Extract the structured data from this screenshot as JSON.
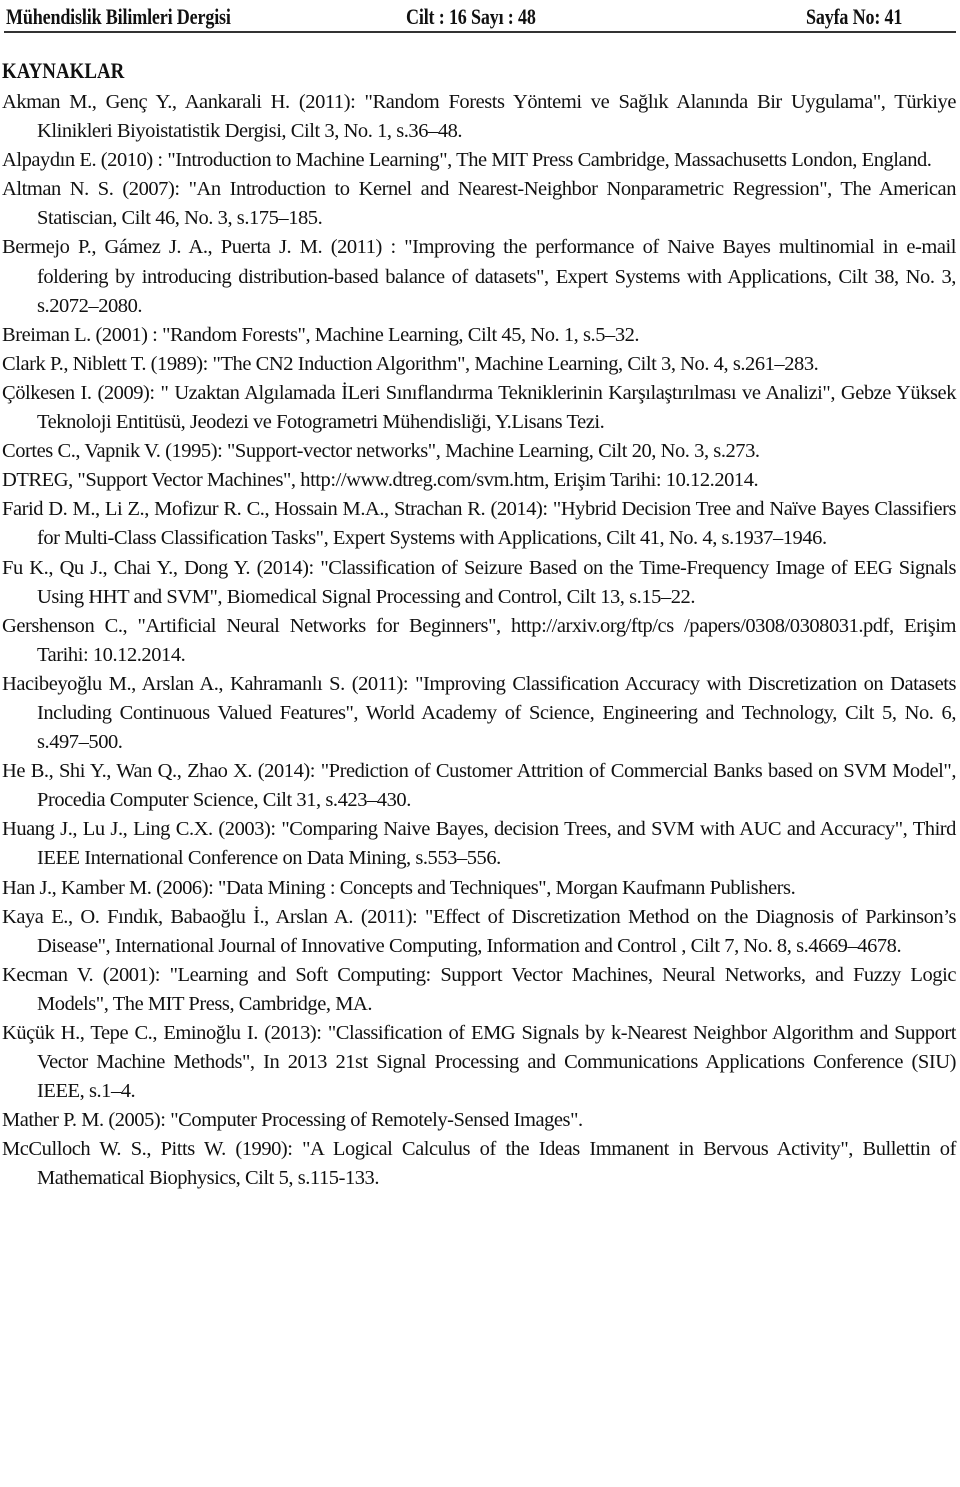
{
  "header": {
    "journal": "Mühendislik Bilimleri Dergisi",
    "issue": "Cilt : 16 Sayı : 48",
    "page": "Sayfa No: 41"
  },
  "section_title": "KAYNAKLAR",
  "references": [
    "Akman M., Genç Y., Aankarali H. (2011): \"Random Forests Yöntemi ve Sağlık Alanında Bir Uygulama\", Türkiye Klinikleri Biyoistatistik Dergisi, Cilt 3, No. 1, s.36–48.",
    "Alpaydın E. (2010) : \"Introduction to Machine Learning\", The MIT Press Cambridge, Massachusetts London, England.",
    "Altman N. S. (2007): \"An Introduction to Kernel and Nearest-Neighbor Nonparametric Regression\", The American Statiscian, Cilt 46, No. 3, s.175–185.",
    "Bermejo P., Gámez J. A., Puerta J. M. (2011) : \"Improving the performance of Naive Bayes multinomial in e-mail foldering by introducing distribution-based balance of datasets\", Expert Systems with Applications, Cilt 38, No. 3, s.2072–2080.",
    "Breiman L. (2001) : \"Random Forests\", Machine Learning, Cilt 45, No. 1, s.5–32.",
    "Clark P., Niblett T. (1989): \"The CN2 Induction Algorithm\",  Machine Learning,  Cilt 3, No. 4, s.261–283.",
    "Çölkesen I. (2009): \" Uzaktan Algılamada İLeri Sınıflandırma Tekniklerinin Karşılaştırılması ve Analizi\", Gebze Yüksek Teknoloji Entitüsü, Jeodezi ve Fotogrametri Mühendisliği, Y.Lisans Tezi.",
    "Cortes C., Vapnik V. (1995): \"Support-vector networks\", Machine Learning, Cilt 20, No. 3, s.273.",
    "DTREG, \"Support Vector Machines\", http://www.dtreg.com/svm.htm, Erişim Tarihi: 10.12.2014.",
    "Farid D. M., Li Z., Mofizur R. C., Hossain M.A., Strachan R. (2014): \"Hybrid Decision Tree and Naïve Bayes Classifiers for Multi-Class Classification Tasks\", Expert Systems with Applications, Cilt 41, No. 4, s.1937–1946.",
    "Fu K., Qu J., Chai Y., Dong Y. (2014): \"Classification of Seizure Based on the Time-Frequency Image of EEG Signals Using HHT and SVM\", Biomedical Signal Processing and Control, Cilt 13, s.15–22.",
    "Gershenson C., \"Artificial Neural Networks for Beginners\", http://arxiv.org/ftp/cs /papers/0308/0308031.pdf, Erişim Tarihi: 10.12.2014.",
    "Hacibeyoğlu M., Arslan A., Kahramanlı S. (2011): \"Improving Classification Accuracy with Discretization on Datasets Including Continuous Valued Features\", World Academy of Science, Engineering and Technology, Cilt 5, No. 6, s.497–500.",
    "He B., Shi Y., Wan Q., Zhao X. (2014): \"Prediction of Customer Attrition of Commercial Banks based on SVM Model\", Procedia Computer Science, Cilt 31, s.423–430.",
    "Huang J., Lu J., Ling C.X. (2003): \"Comparing Naive Bayes, decision Trees, and SVM with AUC and Accuracy\", Third IEEE International Conference on Data Mining, s.553–556.",
    "Han J., Kamber M. (2006):  \"Data Mining : Concepts and Techniques\", Morgan Kaufmann Publishers.",
    "Kaya E., O. Fındık, Babaoğlu İ., Arslan A. (2011): \"Effect of Discretization Method on the Diagnosis of Parkinson’s Disease\", International Journal of Innovative Computing, Information and Control , Cilt 7, No. 8, s.4669–4678.",
    "Kecman V. (2001): \"Learning and Soft Computing: Support Vector Machines, Neural Networks, and Fuzzy Logic Models\", The MIT Press, Cambridge, MA.",
    "Küçük H., Tepe C., Eminoğlu I. (2013): \"Classification of EMG Signals by k-Nearest Neighbor Algorithm and Support Vector Machine Methods\", In 2013 21st Signal Processing and Communications Applications Conference (SIU) IEEE, s.1–4.",
    "Mather P. M. (2005): \"Computer Processing of Remotely-Sensed Images\".",
    "McCulloch W. S., Pitts W. (1990): \"A Logical Calculus of the Ideas Immanent in Bervous Activity\", Bullettin of Mathematical Biophysics, Cilt 5, s.115-133."
  ]
}
